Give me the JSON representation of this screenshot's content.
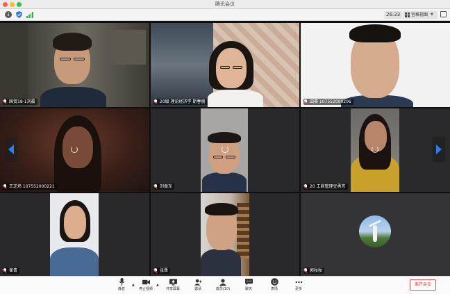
{
  "window": {
    "title": "腾讯会议"
  },
  "topbar": {
    "timer": "26:33",
    "view_mode": "宫格视图",
    "icons": [
      "info-icon",
      "shield-icon",
      "signal-icon",
      "fullscreen-icon"
    ],
    "signal_color": "#2fb344"
  },
  "participants": [
    {
      "name": "国贸18-1刘晨",
      "video": "on"
    },
    {
      "name": "20级 理论经济学 靳春丽",
      "video": "on"
    },
    {
      "name": "田赛 107552000206",
      "video": "on"
    },
    {
      "name": "王芝炜 107552000221",
      "video": "loading"
    },
    {
      "name": "刘振东",
      "video": "loading"
    },
    {
      "name": "20 工商管理豆勇芳",
      "video": "loading"
    },
    {
      "name": "崔青",
      "video": "on"
    },
    {
      "name": "张晋",
      "video": "on"
    },
    {
      "name": "郭秋秋",
      "video": "off-avatar"
    }
  ],
  "controls": {
    "mute": "静音",
    "stop_video": "停止视频",
    "share_screen": "共享屏幕",
    "invite": "邀请",
    "members": "成员(10)",
    "chat": "聊天",
    "reactions": "表情",
    "more": "更多",
    "leave": "离开会议",
    "leave_color": "#e03a3a"
  }
}
